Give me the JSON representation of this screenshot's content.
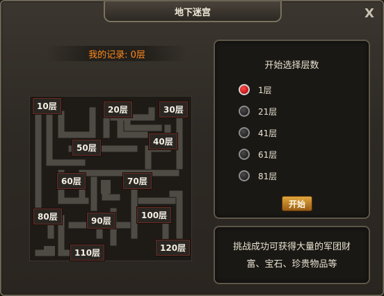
{
  "title": "地下迷宫",
  "close_glyph": "X",
  "record": "我的记录: 0层",
  "floors": [
    "10层",
    "20层",
    "30层",
    "40层",
    "50层",
    "60层",
    "70层",
    "80层",
    "90层",
    "100层",
    "110层",
    "120层"
  ],
  "panel": {
    "title": "开始选择层数",
    "options": [
      "1层",
      "21层",
      "41层",
      "61层",
      "81层"
    ],
    "selected_index": 0,
    "start_label": "开始"
  },
  "description": {
    "line1": "挑战成功可获得大量的军团财",
    "line2": "富、宝石、珍贵物品等"
  },
  "colors": {
    "record_orange": "#ff8a1c",
    "radio_selected": "#e81e1e",
    "start_button": "#c9862a",
    "label_border": "#6b2a22"
  }
}
